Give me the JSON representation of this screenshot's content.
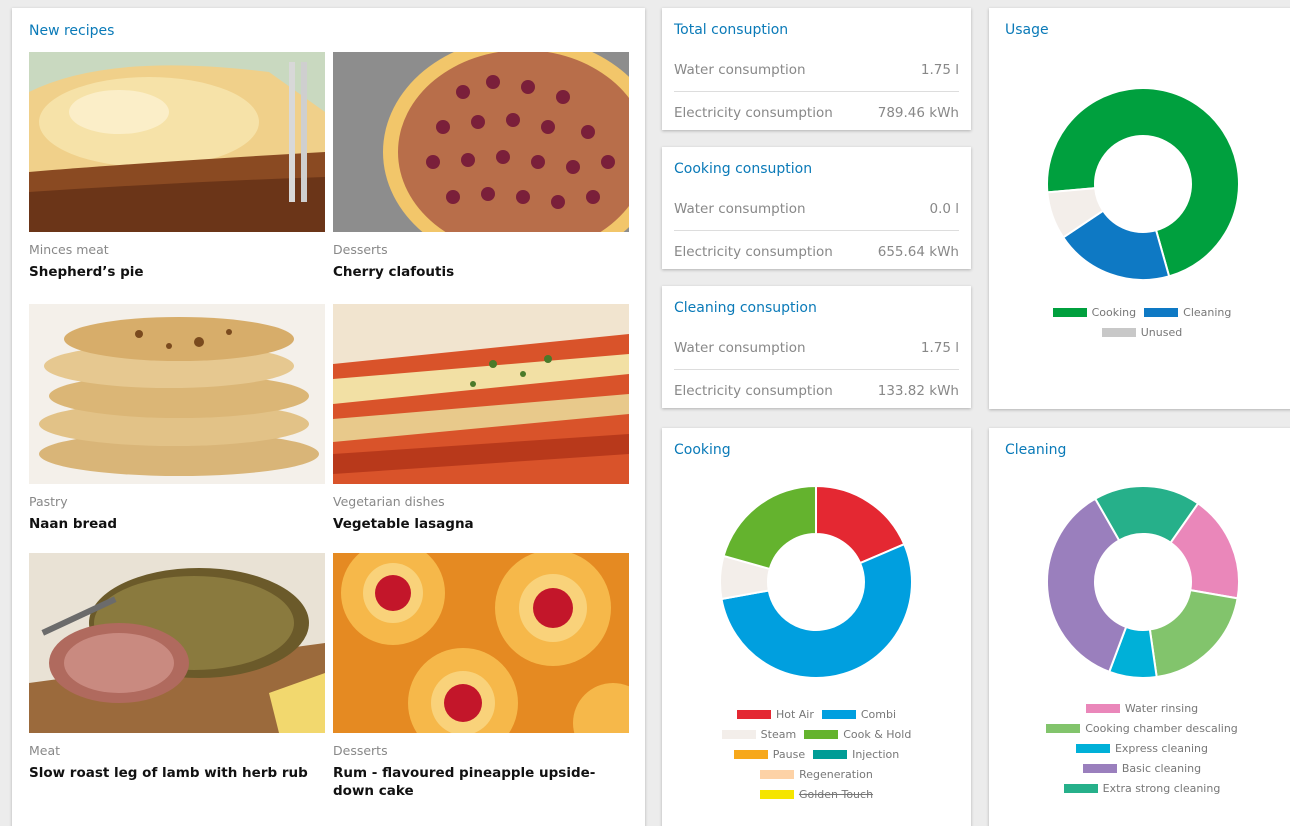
{
  "recipes": {
    "title": "New recipes",
    "items": [
      {
        "category": "Minces meat",
        "name": "Shepherd’s pie"
      },
      {
        "category": "Desserts",
        "name": "Cherry clafoutis"
      },
      {
        "category": "Pastry",
        "name": "Naan bread"
      },
      {
        "category": "Vegetarian dishes",
        "name": "Vegetable lasagna"
      },
      {
        "category": "Meat",
        "name": "Slow roast leg of lamb with herb rub"
      },
      {
        "category": "Desserts",
        "name": "Rum - flavoured pineapple upside-down cake"
      }
    ]
  },
  "total": {
    "title": "Total consuption",
    "water_label": "Water consumption",
    "water_value": "1.75 l",
    "elec_label": "Electricity consumption",
    "elec_value": "789.46 kWh"
  },
  "cooking_cons": {
    "title": "Cooking consuption",
    "water_label": "Water consumption",
    "water_value": "0.0 l",
    "elec_label": "Electricity consumption",
    "elec_value": "655.64 kWh"
  },
  "cleaning_cons": {
    "title": "Cleaning consuption",
    "water_label": "Water consumption",
    "water_value": "1.75 l",
    "elec_label": "Electricity consumption",
    "elec_value": "133.82 kWh"
  },
  "usage": {
    "title": "Usage"
  },
  "cooking": {
    "title": "Cooking"
  },
  "cleaning": {
    "title": "Cleaning"
  },
  "chart_data": [
    {
      "type": "pie",
      "title": "Usage",
      "categories": [
        "Cooking",
        "Cleaning",
        "Unused"
      ],
      "values": [
        72,
        20,
        8
      ],
      "colors": [
        "#00a03e",
        "#0e79c4",
        "#f3eeea"
      ],
      "legend_colors": [
        "#00a03e",
        "#0e79c4",
        "#c8c8c8"
      ],
      "disabled": [
        false,
        false,
        false
      ]
    },
    {
      "type": "pie",
      "title": "Cooking",
      "categories": [
        "Hot Air",
        "Combi",
        "Steam",
        "Cook & Hold",
        "Pause",
        "Injection",
        "Regeneration",
        "Golden Touch"
      ],
      "values": [
        18,
        52,
        7,
        20,
        0,
        0,
        0,
        0
      ],
      "colors": [
        "#e42832",
        "#009fdf",
        "#f3eeea",
        "#64b32e",
        "#f7a81b",
        "#009c95",
        "#fdd2a6",
        "#f5e500"
      ],
      "legend_colors": [
        "#e42832",
        "#009fdf",
        "#f3eeea",
        "#64b32e",
        "#f7a81b",
        "#009c95",
        "#fdd2a6",
        "#f5e500"
      ],
      "disabled": [
        false,
        false,
        false,
        false,
        false,
        false,
        false,
        true
      ]
    },
    {
      "type": "pie",
      "title": "Cleaning",
      "categories": [
        "Water rinsing",
        "Cooking chamber descaling",
        "Express cleaning",
        "Basic cleaning",
        "Extra strong cleaning"
      ],
      "values": [
        18,
        20,
        8,
        36,
        18
      ],
      "colors": [
        "#ea87ba",
        "#82c46c",
        "#00b0d8",
        "#9a7fbd",
        "#26b08a"
      ],
      "legend_colors": [
        "#ea87ba",
        "#82c46c",
        "#00b0d8",
        "#9a7fbd",
        "#26b08a"
      ],
      "disabled": [
        false,
        false,
        false,
        false,
        false
      ]
    }
  ]
}
